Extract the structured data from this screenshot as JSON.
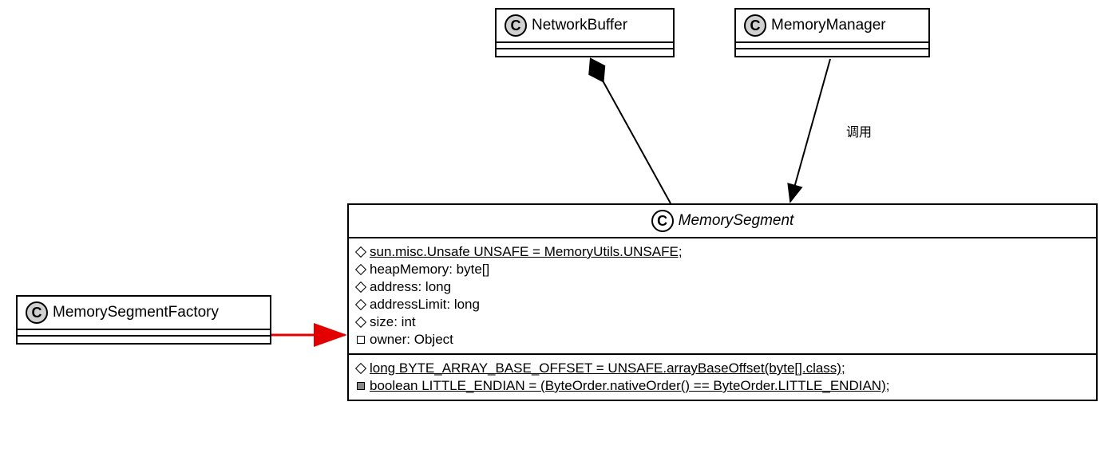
{
  "classes": {
    "networkBuffer": {
      "name": "NetworkBuffer"
    },
    "memoryManager": {
      "name": "MemoryManager"
    },
    "memorySegmentFactory": {
      "name": "MemorySegmentFactory"
    },
    "memorySegment": {
      "name": "MemorySegment",
      "attributes": [
        {
          "vis": "diamond",
          "text": "sun.misc.Unsafe UNSAFE = MemoryUtils.UNSAFE;",
          "underline": true
        },
        {
          "vis": "diamond",
          "text": "heapMemory: byte[]",
          "underline": false
        },
        {
          "vis": "diamond",
          "text": "address: long",
          "underline": false
        },
        {
          "vis": "diamond",
          "text": "addressLimit: long",
          "underline": false
        },
        {
          "vis": "diamond",
          "text": "size: int",
          "underline": false
        },
        {
          "vis": "square",
          "text": "owner: Object",
          "underline": false
        }
      ],
      "statics": [
        {
          "vis": "diamond",
          "text": "long BYTE_ARRAY_BASE_OFFSET = UNSAFE.arrayBaseOffset(byte[].class);",
          "underline": true
        },
        {
          "vis": "square-filled",
          "text": "boolean LITTLE_ENDIAN = (ByteOrder.nativeOrder() == ByteOrder.LITTLE_ENDIAN);",
          "underline": true
        }
      ]
    }
  },
  "relationLabel": "调用"
}
